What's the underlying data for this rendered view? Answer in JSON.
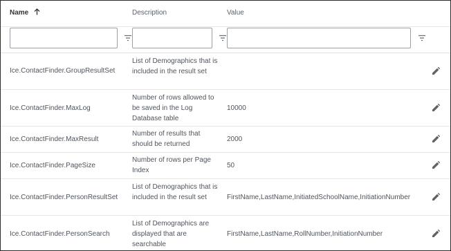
{
  "columns": {
    "name": "Name",
    "description": "Description",
    "value": "Value"
  },
  "filters": {
    "name": "",
    "description": "",
    "value": ""
  },
  "rows": [
    {
      "name": "Ice.ContactFinder.GroupResultSet",
      "description": "List of Demographics that is included in the result set",
      "value": ""
    },
    {
      "name": "Ice.ContactFinder.MaxLog",
      "description": "Number of rows allowed to be saved in the Log Database table",
      "value": "10000"
    },
    {
      "name": "Ice.ContactFinder.MaxResult",
      "description": "Number of results that should be returned",
      "value": "2000"
    },
    {
      "name": "Ice.ContactFinder.PageSize",
      "description": "Number of rows per Page Index",
      "value": "50"
    },
    {
      "name": "Ice.ContactFinder.PersonResultSet",
      "description": "List of Demographics that is included in the result set",
      "value": "FirstName,LastName,InitiatedSchoolName,InitiationNumber"
    },
    {
      "name": "Ice.ContactFinder.PersonSearch",
      "description": "List of Demographics are displayed that are searchable",
      "value": "FirstName,LastName,RollNumber,InitiationNumber"
    }
  ],
  "icons": {
    "sort": "arrow-up-icon",
    "filter": "filter-icon",
    "edit": "pencil-icon"
  }
}
